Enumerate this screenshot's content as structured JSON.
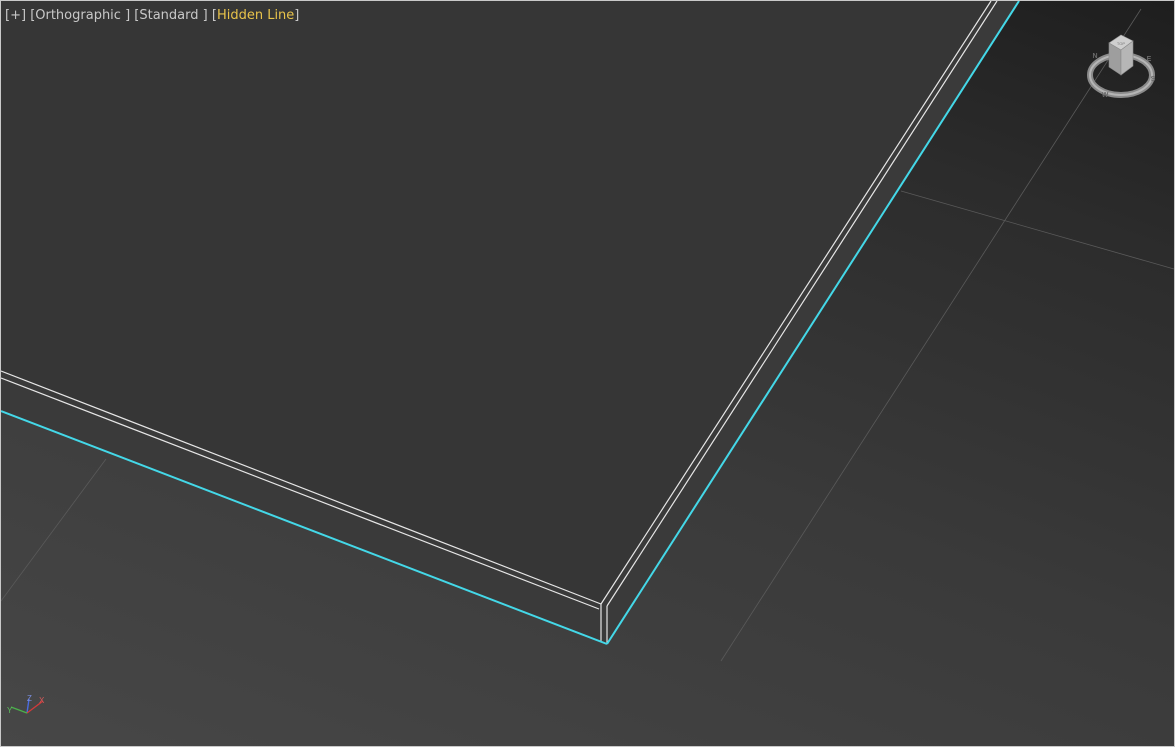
{
  "viewport": {
    "label": {
      "plus": "[+]",
      "projection": "[Orthographic ]",
      "mode": "[Standard ]",
      "shading_open": "[",
      "shading": "Hidden Line",
      "shading_close": "]"
    },
    "selection_color": "#44d8e8",
    "wire_color": "#e6e6e6",
    "shading_color": "#e8c34a"
  },
  "viewcube": {
    "face_top_label": "TOP",
    "compass": {
      "n": "N",
      "e": "E",
      "s": "S",
      "w": "W"
    }
  },
  "axis_tripod": {
    "x": "X",
    "y": "Y",
    "z": "Z"
  }
}
